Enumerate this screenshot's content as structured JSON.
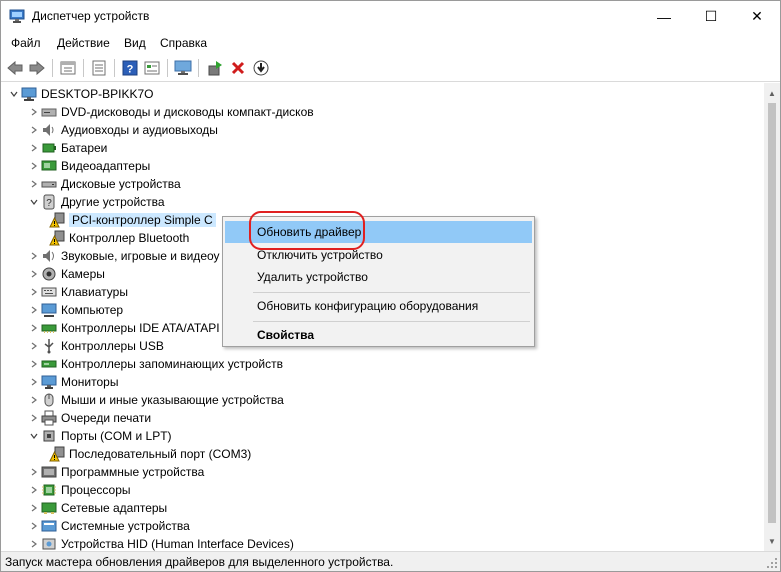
{
  "window": {
    "title": "Диспетчер устройств",
    "controls": {
      "minimize": "—",
      "maximize": "☐",
      "close": "✕"
    }
  },
  "menu": [
    "Файл",
    "Действие",
    "Вид",
    "Справка"
  ],
  "toolbar": [
    "back-icon",
    "forward-icon",
    "properties-icon",
    "list-icon",
    "help-icon",
    "details-icon",
    "monitor-icon",
    "update-driver-icon",
    "uninstall-icon",
    "download-icon"
  ],
  "tree": {
    "root": "DESKTOP-BPIKK7O",
    "items": [
      {
        "label": "DVD-дисководы и дисководы компакт-дисков",
        "icon": "dvd-icon"
      },
      {
        "label": "Аудиовходы и аудиовыходы",
        "icon": "audio-icon"
      },
      {
        "label": "Батареи",
        "icon": "battery-icon"
      },
      {
        "label": "Видеоадаптеры",
        "icon": "display-adapter-icon"
      },
      {
        "label": "Дисковые устройства",
        "icon": "disk-icon"
      },
      {
        "label": "Другие устройства",
        "icon": "other-devices-icon",
        "expanded": true
      },
      {
        "label": "PCI-контроллер Simple C",
        "icon": "warning-device-icon",
        "child": true,
        "selected": true
      },
      {
        "label": "Контроллер Bluetooth",
        "icon": "warning-device-icon",
        "child": true
      },
      {
        "label": "Звуковые, игровые и видеоу",
        "icon": "sound-icon"
      },
      {
        "label": "Камеры",
        "icon": "camera-icon"
      },
      {
        "label": "Клавиатуры",
        "icon": "keyboard-icon"
      },
      {
        "label": "Компьютер",
        "icon": "computer-icon"
      },
      {
        "label": "Контроллеры IDE ATA/ATAPI",
        "icon": "ide-icon"
      },
      {
        "label": "Контроллеры USB",
        "icon": "usb-icon"
      },
      {
        "label": "Контроллеры запоминающих устройств",
        "icon": "storage-icon"
      },
      {
        "label": "Мониторы",
        "icon": "monitor-icon"
      },
      {
        "label": "Мыши и иные указывающие устройства",
        "icon": "mouse-icon"
      },
      {
        "label": "Очереди печати",
        "icon": "printer-icon"
      },
      {
        "label": "Порты (COM и LPT)",
        "icon": "port-icon",
        "expanded": true
      },
      {
        "label": "Последовательный порт (COM3)",
        "icon": "warning-device-icon",
        "child": true
      },
      {
        "label": "Программные устройства",
        "icon": "software-icon"
      },
      {
        "label": "Процессоры",
        "icon": "cpu-icon"
      },
      {
        "label": "Сетевые адаптеры",
        "icon": "network-icon"
      },
      {
        "label": "Системные устройства",
        "icon": "system-icon"
      },
      {
        "label": "Устройства HID (Human Interface Devices)",
        "icon": "hid-icon"
      }
    ]
  },
  "context_menu": [
    {
      "label": "Обновить драйвер",
      "highlighted": true
    },
    {
      "label": "Отключить устройство"
    },
    {
      "label": "Удалить устройство"
    },
    {
      "label": "Обновить конфигурацию оборудования"
    },
    {
      "label": "Свойства",
      "bold": true
    }
  ],
  "status": "Запуск мастера обновления драйверов для выделенного устройства.",
  "colors": {
    "accent": "#91c9f7",
    "ring": "#e02020",
    "selected": "#cce8ff",
    "warning": "#f5c400"
  }
}
